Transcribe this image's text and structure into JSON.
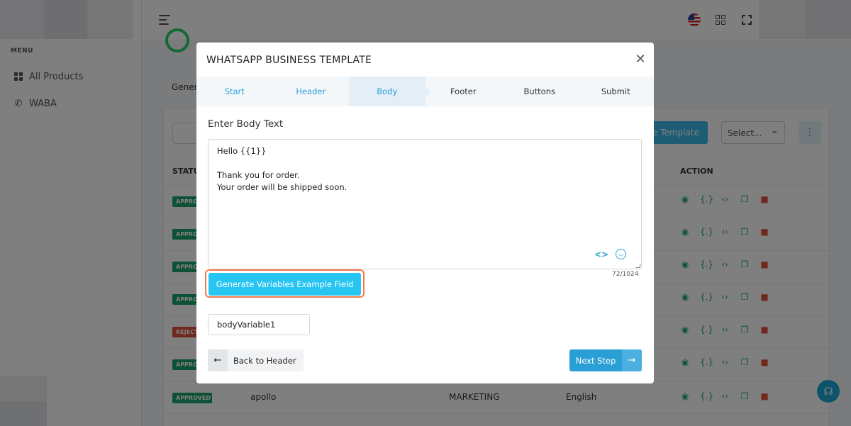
{
  "sidebar": {
    "menu_label": "MENU",
    "items": [
      {
        "label": "All Products",
        "icon": "grid-icon"
      },
      {
        "label": "WABA",
        "icon": "whatsapp-icon"
      }
    ]
  },
  "background": {
    "tab_partial": "Gener",
    "create_button_partial": "e Template",
    "select_placeholder": "Select...",
    "columns": {
      "status": "STATUS",
      "action": "ACTION"
    },
    "rows": [
      {
        "status": "APPROVED"
      },
      {
        "status": "APPROVED"
      },
      {
        "status": "APPROVED"
      },
      {
        "status": "APPROVED"
      },
      {
        "status": "REJECTED"
      },
      {
        "status": "APPROVED"
      },
      {
        "status": "APPROVED",
        "name": "apollo",
        "category": "MARKETING",
        "language": "English"
      }
    ]
  },
  "modal": {
    "title": "WHATSAPP BUSINESS TEMPLATE",
    "steps": [
      "Start",
      "Header",
      "Body",
      "Footer",
      "Buttons",
      "Submit"
    ],
    "active_step": "Body",
    "section_label": "Enter Body Text",
    "body_text": "Hello  {{1}}\n\nThank you for order.\nYour order will  be shipped soon.",
    "char_count": "72/1024",
    "generate_button": "Generate Variables Example Field",
    "variable_value": "bodyVariable1",
    "back_button": "Back to Header",
    "next_button": "Next Step"
  },
  "colors": {
    "primary": "#2a9fd6",
    "generate_button": "#27c5f2",
    "highlight": "#f07a4a",
    "approved": "#1aa36e",
    "rejected": "#e0513a"
  }
}
